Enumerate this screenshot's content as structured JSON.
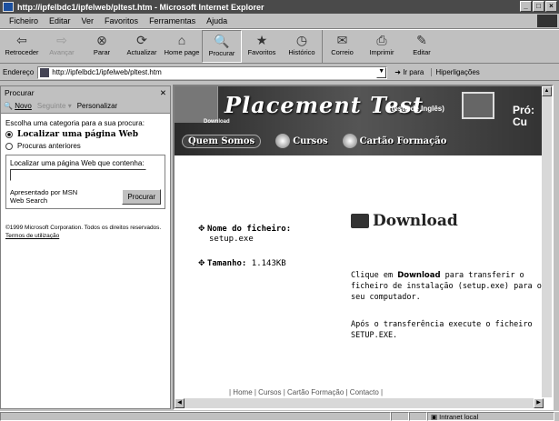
{
  "window": {
    "title": "http://ipfelbdc1/ipfelweb/pltest.htm - Microsoft Internet Explorer"
  },
  "menu": [
    "Ficheiro",
    "Editar",
    "Ver",
    "Favoritos",
    "Ferramentas",
    "Ajuda"
  ],
  "toolbar": [
    {
      "label": "Retroceder",
      "icon": "back-arrow-icon",
      "glyph": "⇦"
    },
    {
      "label": "Avançar",
      "icon": "forward-arrow-icon",
      "glyph": "⇨",
      "disabled": true
    },
    {
      "label": "Parar",
      "icon": "stop-icon",
      "glyph": "⊗"
    },
    {
      "label": "Actualizar",
      "icon": "refresh-icon",
      "glyph": "⟳"
    },
    {
      "label": "Home page",
      "icon": "home-icon",
      "glyph": "⌂"
    },
    {
      "label": "Procurar",
      "icon": "search-icon",
      "glyph": "🔍"
    },
    {
      "label": "Favoritos",
      "icon": "favorites-icon",
      "glyph": "★"
    },
    {
      "label": "Histórico",
      "icon": "history-icon",
      "glyph": "◷"
    },
    {
      "label": "Correio",
      "icon": "mail-icon",
      "glyph": "✉"
    },
    {
      "label": "Imprimir",
      "icon": "print-icon",
      "glyph": "⎙"
    },
    {
      "label": "Editar",
      "icon": "edit-icon",
      "glyph": "✎"
    }
  ],
  "address": {
    "label": "Endereço",
    "url": "http://ipfelbdc1/ipfelweb/pltest.htm",
    "go": "Ir para",
    "links": "Hiperligações"
  },
  "search_pane": {
    "title": "Procurar",
    "new": "Novo",
    "next": "Seguinte",
    "customize": "Personalizar",
    "prompt": "Escolha uma categoria para a sua procura:",
    "option_web": "Localizar uma página Web",
    "option_previous": "Procuras anteriores",
    "find_label": "Localizar uma página Web que contenha:",
    "provider": "Apresentado por MSN Web Search",
    "search_button": "Procurar",
    "copyright": "©1999 Microsoft Corporation. Todos os direitos reservados.",
    "terms": "Termos de utilização"
  },
  "page": {
    "banner_title": "Placement Test",
    "banner_sub": "(teste de Inglês)",
    "banner_side": "Pró: Cu",
    "banner_strip": "Download",
    "nav": [
      "Quem Somos",
      "Cursos",
      "Cartão Formação"
    ],
    "file_label": "Nome do ficheiro:",
    "file_value": "setup.exe",
    "size_label": "Tamanho:",
    "size_value": "1.143KB",
    "download_title": "Download",
    "para1_pre": "Clique em ",
    "para1_bold": "Download",
    "para1_post": " para transferir o ficheiro de instalação (setup.exe) para o seu computador.",
    "para2": "Após o transferência execute o ficheiro SETUP.EXE.",
    "footer": "| Home | Cursos | Cartão Formação | Contacto |"
  },
  "status": {
    "left": "",
    "zone": "Intranet local"
  }
}
